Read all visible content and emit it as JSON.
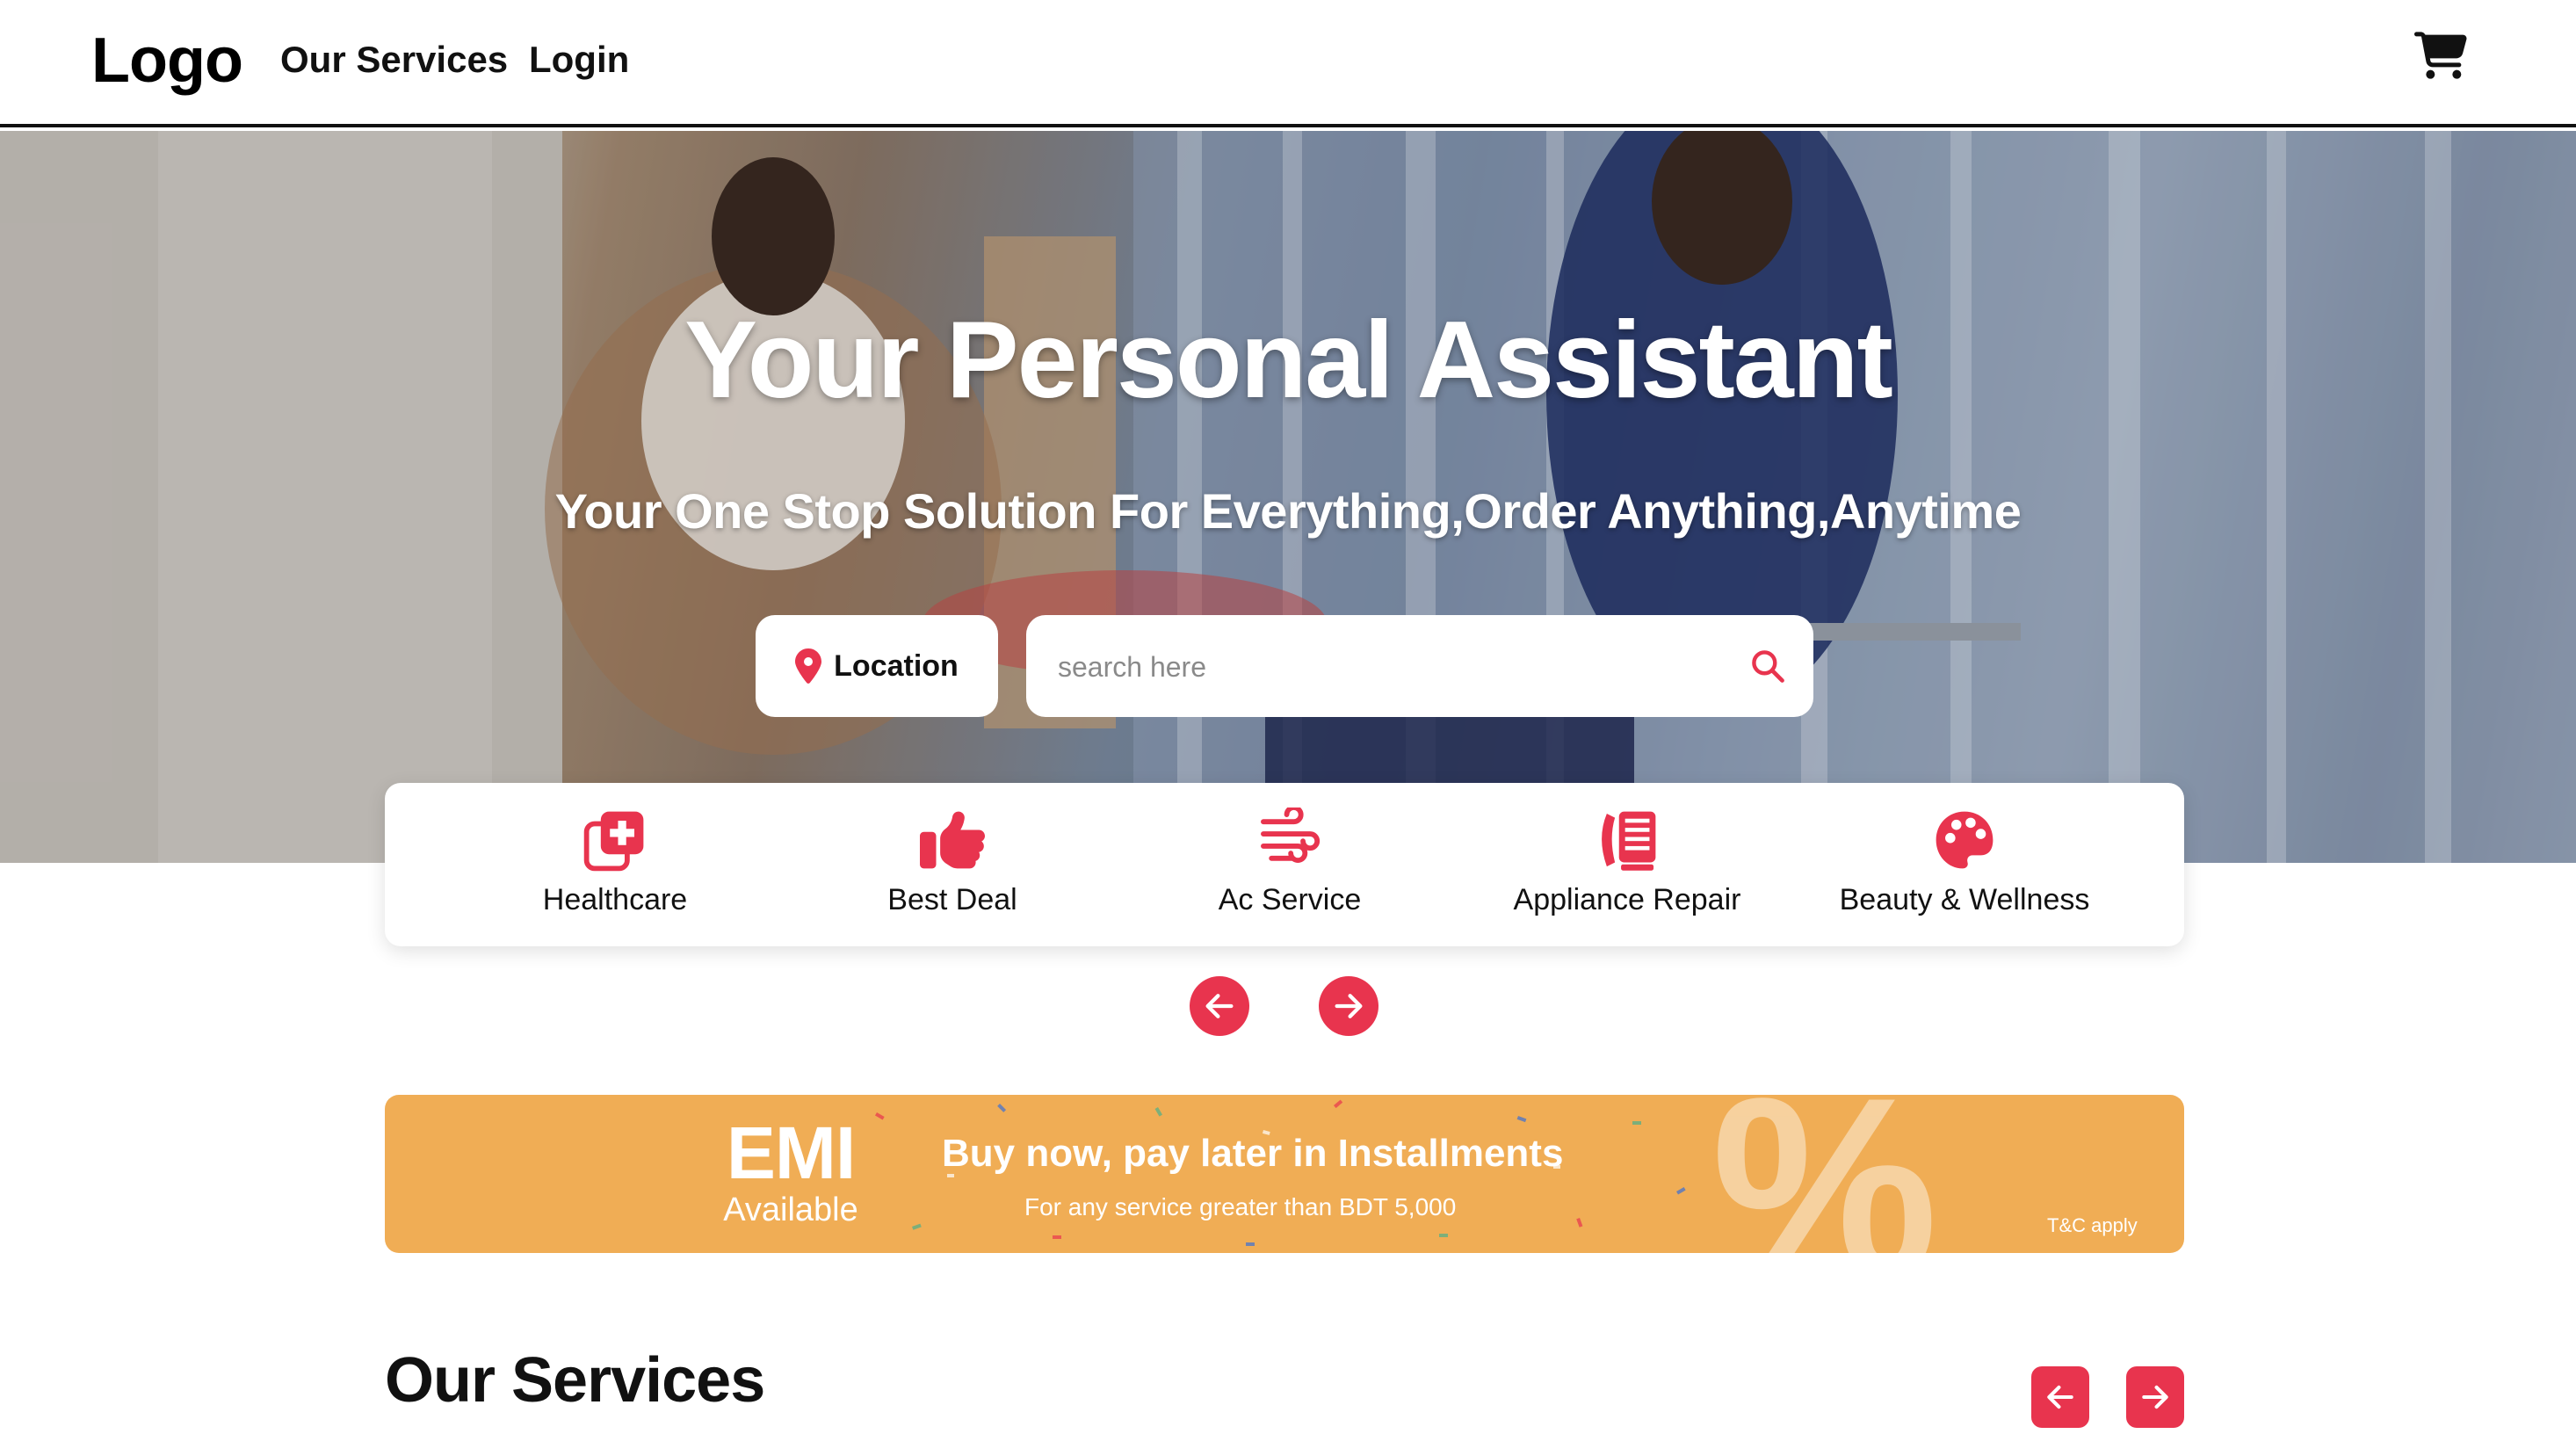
{
  "navbar": {
    "logo": "Logo",
    "links": [
      "Our Services",
      "Login"
    ],
    "cart_icon": "cart-icon"
  },
  "hero": {
    "title": "Your Personal Assistant",
    "subtitle": "Your One Stop Solution For Everything,Order Anything,Anytime",
    "location_label": "Location",
    "location_icon": "map-pin-icon",
    "search_placeholder": "search here",
    "search_icon": "search-icon"
  },
  "categories": [
    {
      "label": "Healthcare",
      "icon": "medical-plus-icon"
    },
    {
      "label": "Best Deal",
      "icon": "thumbs-up-icon"
    },
    {
      "label": "Ac Service",
      "icon": "wind-icon"
    },
    {
      "label": "Appliance Repair",
      "icon": "phone-fax-icon"
    },
    {
      "label": "Beauty & Wellness",
      "icon": "palette-icon"
    }
  ],
  "carousel_nav": {
    "prev_icon": "arrow-left-icon",
    "next_icon": "arrow-right-icon"
  },
  "emi_banner": {
    "title": "EMI",
    "subtitle": "Available",
    "headline": "Buy now, pay later in Installments",
    "detail": "For any service greater than BDT 5,000",
    "percent": "%",
    "terms": "T&C apply"
  },
  "services_section": {
    "title": "Our Services",
    "prev_icon": "arrow-left-icon",
    "next_icon": "arrow-right-icon"
  },
  "colors": {
    "accent": "#e8344e",
    "banner": "#f0ad55",
    "navbar_border": "#111111"
  }
}
